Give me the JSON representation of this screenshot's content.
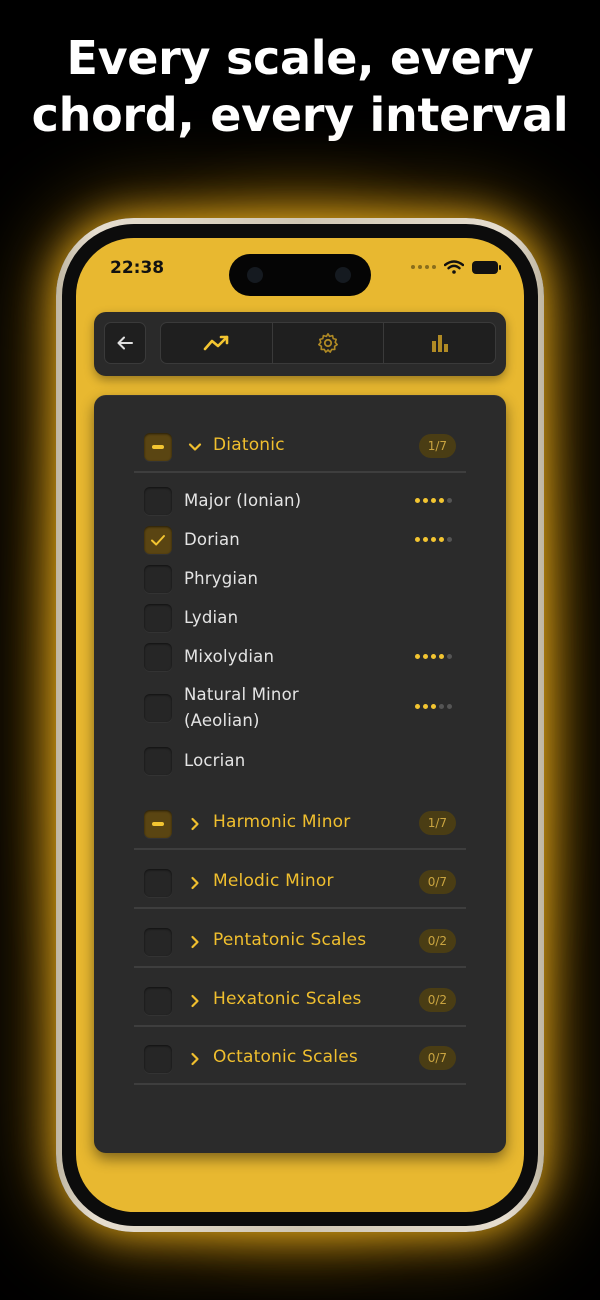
{
  "headline": {
    "line1": "Every scale, every",
    "line2": "chord, every interval"
  },
  "status_bar": {
    "time": "22:38"
  },
  "toolbar": {
    "back_icon": "arrow-left-icon",
    "tabs": [
      {
        "icon": "trend-line-icon",
        "active": true
      },
      {
        "icon": "gear-icon",
        "active": false
      },
      {
        "icon": "bar-chart-icon",
        "active": false
      }
    ]
  },
  "colors": {
    "accent": "#f0bf2e",
    "screen_bg": "#e8b830",
    "panel_bg": "#2b2b2b"
  },
  "groups": [
    {
      "title": "Diatonic",
      "count": "1/7",
      "expanded": true,
      "state": "partial",
      "items": [
        {
          "label": "Major (Ionian)",
          "checked": false,
          "rating": 4,
          "rating_max": 5
        },
        {
          "label": "Dorian",
          "checked": true,
          "rating": 4,
          "rating_max": 5
        },
        {
          "label": "Phrygian",
          "checked": false,
          "rating": 0,
          "rating_max": 0
        },
        {
          "label": "Lydian",
          "checked": false,
          "rating": 0,
          "rating_max": 0
        },
        {
          "label": "Mixolydian",
          "checked": false,
          "rating": 4,
          "rating_max": 5
        },
        {
          "label_line1": "Natural Minor",
          "label_line2": "(Aeolian)",
          "checked": false,
          "rating": 3,
          "rating_max": 5
        },
        {
          "label": "Locrian",
          "checked": false,
          "rating": 0,
          "rating_max": 0
        }
      ]
    },
    {
      "title": "Harmonic Minor",
      "count": "1/7",
      "expanded": false,
      "state": "partial"
    },
    {
      "title": "Melodic Minor",
      "count": "0/7",
      "expanded": false,
      "state": "empty"
    },
    {
      "title": "Pentatonic Scales",
      "count": "0/2",
      "expanded": false,
      "state": "empty"
    },
    {
      "title": "Hexatonic Scales",
      "count": "0/2",
      "expanded": false,
      "state": "empty"
    },
    {
      "title": "Octatonic Scales",
      "count": "0/7",
      "expanded": false,
      "state": "empty"
    }
  ]
}
